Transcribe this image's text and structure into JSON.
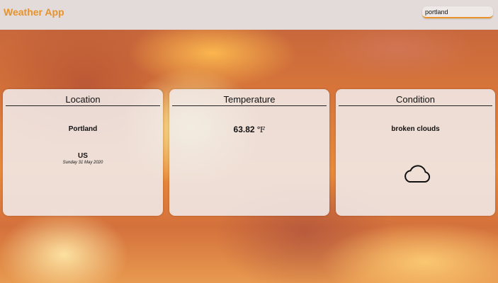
{
  "header": {
    "title": "Weather App",
    "search_value": "portland"
  },
  "cards": {
    "location": {
      "title": "Location",
      "city": "Portland",
      "country": "US",
      "date": "Sunday 31 May 2020"
    },
    "temperature": {
      "title": "Temperature",
      "value": "63.82",
      "unit": "℉"
    },
    "condition": {
      "title": "Condition",
      "description": "broken clouds",
      "icon": "cloud-icon"
    }
  },
  "colors": {
    "accent": "#e8922a",
    "navbar": "#e2dbd9",
    "card": "#f0eaea"
  }
}
